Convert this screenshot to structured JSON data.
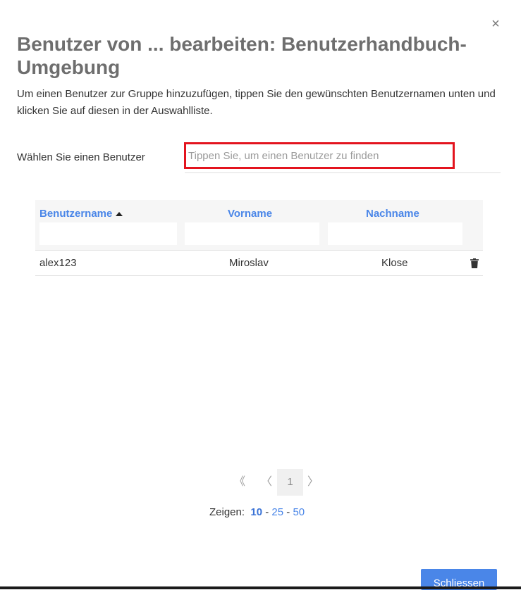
{
  "dialog": {
    "close_glyph": "×",
    "title": "Benutzer von ... bearbeiten: Benutzerhandbuch-Umgebung",
    "intro": "Um einen Benutzer zur Gruppe hinzuzufügen, tippen Sie den gewünschten Benutzernamen unten und klicken Sie auf diesen in der Auswahlliste."
  },
  "user_select": {
    "label": "Wählen Sie einen Benutzer",
    "placeholder": "Tippen Sie, um einen Benutzer zu finden",
    "value": "",
    "highlight_color": "#e3141e"
  },
  "table": {
    "columns": [
      {
        "label": "Benutzername",
        "sorted": "ascending"
      },
      {
        "label": "Vorname"
      },
      {
        "label": "Nachname"
      }
    ],
    "filters": [
      "",
      "",
      ""
    ],
    "rows": [
      {
        "username": "alex123",
        "first_name": "Miroslav",
        "last_name": "Klose",
        "action_icon": "trash-icon"
      }
    ]
  },
  "pagination": {
    "first_glyph": "《",
    "prev_glyph": "〈",
    "current_page": "1",
    "next_glyph": "〉",
    "show_label": "Zeigen:",
    "page_sizes": [
      "10",
      "25",
      "50"
    ],
    "active_page_size": "10",
    "separator": "-"
  },
  "footer": {
    "close_button": "Schliessen"
  },
  "colors": {
    "accent": "#4a86e8",
    "title": "#6e6e6e",
    "header_bg": "#f6f6f6"
  }
}
